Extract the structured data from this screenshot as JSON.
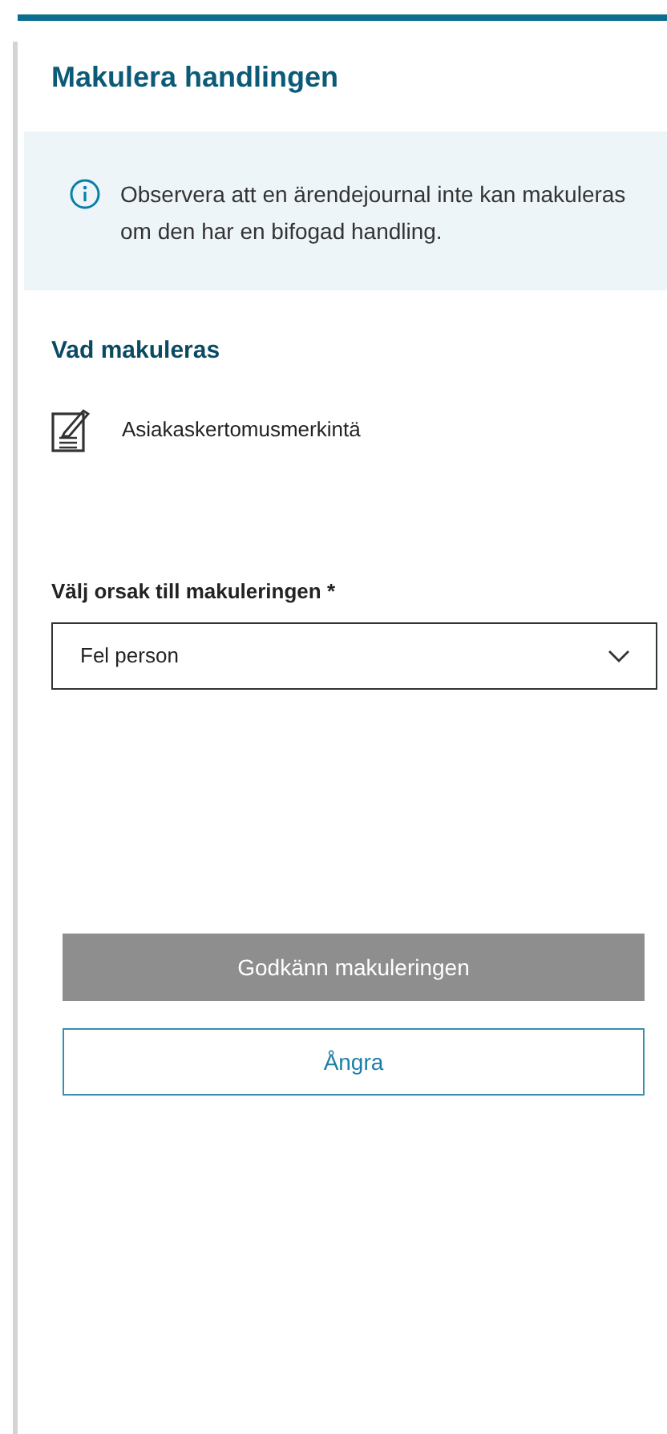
{
  "panel": {
    "title": "Makulera handlingen"
  },
  "notice": {
    "text": "Observera att en ärendejournal inte kan makuleras om den har en bifogad handling."
  },
  "section": {
    "title": "Vad makuleras",
    "item": "Asiakaskertomusmerkintä"
  },
  "reason": {
    "label": "Välj orsak till makuleringen *",
    "value": "Fel person"
  },
  "buttons": [
    {
      "label": "Godkänn makuleringen",
      "kind": "primary",
      "disabled": true
    },
    {
      "label": "Ångra",
      "kind": "secondary",
      "disabled": false
    }
  ]
}
